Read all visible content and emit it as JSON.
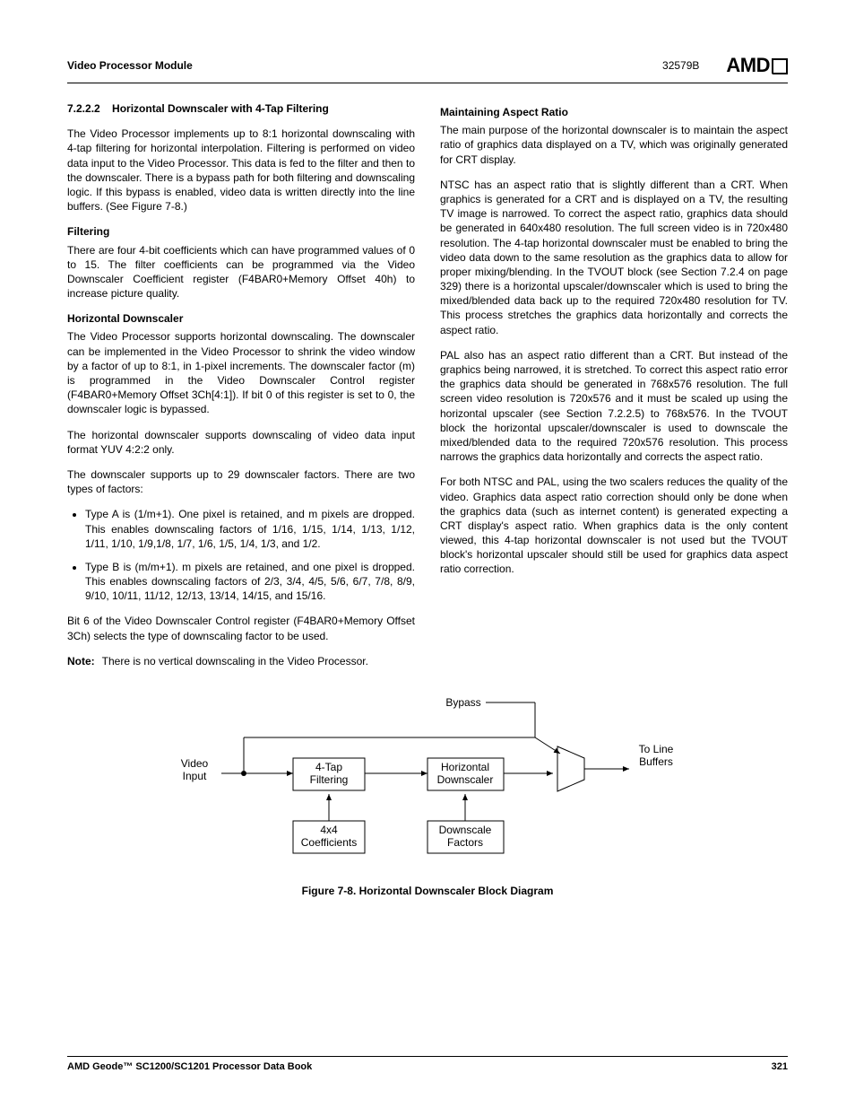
{
  "header": {
    "module": "Video Processor Module",
    "docnum": "32579B",
    "logo": "AMD"
  },
  "col1": {
    "sec_num": "7.2.2.2",
    "sec_title": "Horizontal Downscaler with 4-Tap Filtering",
    "p1": "The Video Processor implements up to 8:1 horizontal downscaling with 4-tap filtering for horizontal interpolation. Filtering is performed on video data input to the Video Processor. This data is fed to the filter and then to the downscaler. There is a bypass path for both filtering and downscaling logic. If this bypass is enabled, video data is written directly into the line buffers. (See Figure 7-8.)",
    "sub1": "Filtering",
    "p2": "There are four 4-bit coefficients which can have programmed values of 0 to 15. The filter coefficients can be programmed via the Video Downscaler Coefficient register (F4BAR0+Memory Offset 40h) to increase picture quality.",
    "sub2": "Horizontal Downscaler",
    "p3": "The Video Processor supports horizontal downscaling. The downscaler can be implemented in the Video Processor to shrink the video window by a factor of up to 8:1, in 1-pixel increments. The downscaler factor (m) is programmed in the Video Downscaler Control register (F4BAR0+Memory Offset 3Ch[4:1]). If bit 0 of this register is set to 0, the downscaler logic is bypassed.",
    "p4": "The horizontal downscaler supports downscaling of video data input format YUV 4:2:2 only.",
    "p5": "The downscaler supports up to 29 downscaler factors. There are two types of factors:",
    "li1": "Type A is (1/m+1). One pixel is retained, and m pixels are dropped. This enables downscaling factors of 1/16, 1/15, 1/14, 1/13, 1/12, 1/11, 1/10, 1/9,1/8, 1/7, 1/6, 1/5, 1/4, 1/3, and 1/2.",
    "li2": "Type B is (m/m+1). m pixels are retained, and one pixel is dropped. This enables downscaling factors of 2/3, 3/4, 4/5, 5/6, 6/7, 7/8, 8/9, 9/10, 10/11, 11/12, 12/13, 13/14, 14/15, and 15/16.",
    "p6": "Bit 6 of the Video Downscaler Control register (F4BAR0+Memory Offset 3Ch) selects the type of downscaling factor to be used.",
    "note_label": "Note:",
    "note_text": "There is no vertical downscaling in the Video Processor."
  },
  "col2": {
    "sub1": "Maintaining Aspect Ratio",
    "p1": "The main purpose of the horizontal downscaler is to maintain the aspect ratio of graphics data displayed on a TV, which was originally generated for CRT display.",
    "p2": "NTSC has an aspect ratio that is slightly different than a CRT. When graphics is generated for a CRT and is displayed on a TV, the resulting TV image is narrowed. To correct the aspect ratio, graphics data should be generated in 640x480 resolution. The full screen video is in 720x480 resolution. The 4-tap horizontal downscaler must be enabled to bring the video data down to the same resolution as the graphics data to allow for proper mixing/blending. In the TVOUT block (see Section 7.2.4 on page 329) there is a horizontal upscaler/downscaler which is used to bring the mixed/blended data back up to the required 720x480 resolution for TV. This process stretches the graphics data horizontally and corrects the aspect ratio.",
    "p3": "PAL also has an aspect ratio different than a CRT. But instead of the graphics being narrowed, it is stretched. To correct this aspect ratio error the graphics data should be generated in 768x576 resolution. The full screen video resolution is 720x576 and it must be scaled up using the horizontal upscaler (see Section 7.2.2.5) to 768x576. In the TVOUT block the horizontal upscaler/downscaler is used to downscale the mixed/blended data to the required 720x576 resolution. This process narrows the graphics data horizontally and corrects the aspect ratio.",
    "p4": "For both NTSC and PAL, using the two scalers reduces the quality of the video. Graphics data aspect ratio correction should only be done when the graphics data (such as internet content) is generated expecting a CRT display's aspect ratio. When graphics data is the only content viewed, this 4-tap horizontal downscaler is not used but the TVOUT block's horizontal upscaler should still be used for graphics data aspect ratio correction."
  },
  "diagram": {
    "video_input": "Video\nInput",
    "filter_top": "4-Tap",
    "filter_bot": "Filtering",
    "coef_top": "4x4",
    "coef_bot": "Coefficients",
    "down_top": "Horizontal",
    "down_bot": "Downscaler",
    "factor_top": "Downscale",
    "factor_bot": "Factors",
    "bypass": "Bypass",
    "out_top": "To Line",
    "out_bot": "Buffers"
  },
  "figure_caption": "Figure 7-8.  Horizontal Downscaler Block Diagram",
  "footer": {
    "book": "AMD Geode™ SC1200/SC1201 Processor Data Book",
    "page": "321"
  }
}
